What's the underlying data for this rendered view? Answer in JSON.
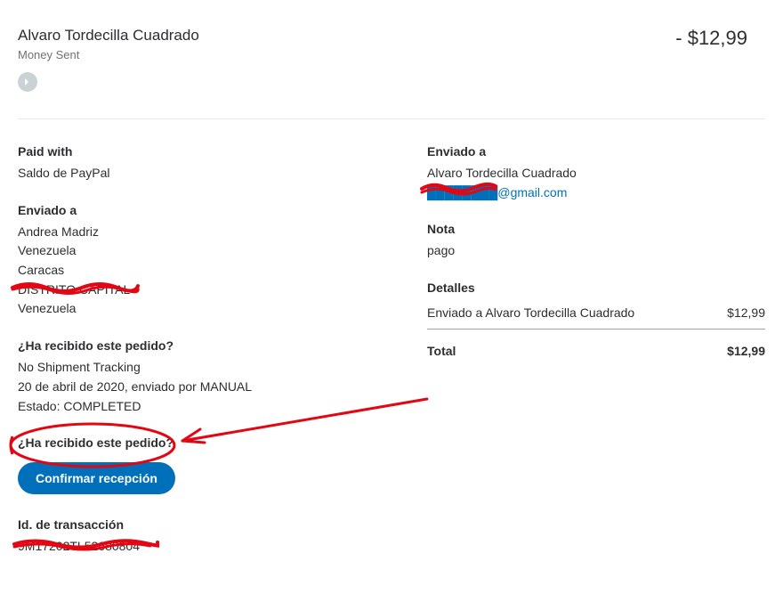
{
  "header": {
    "name": "Alvaro Tordecilla Cuadrado",
    "status": "Money Sent",
    "amount": "- $12,99"
  },
  "left": {
    "paid_with_title": "Paid with",
    "paid_with_value": "Saldo de PayPal",
    "shipped_to_title": "Enviado a",
    "ship_name": "Andrea Madriz",
    "ship_country1": "Venezuela",
    "ship_city": "Caracas",
    "ship_district": "DISTRITO CAPITAL",
    "ship_country2": "Venezuela",
    "received_q1": "¿Ha recibido este pedido?",
    "no_tracking": "No Shipment Tracking",
    "ship_date": "20 de abril de 2020, enviado por MANUAL",
    "state": "Estado: COMPLETED",
    "received_q2": "¿Ha recibido este pedido?",
    "confirm_btn": "Confirmar recepción",
    "txn_title": "Id. de transacción",
    "txn_value": "9M17202TL52680804"
  },
  "right": {
    "sent_to_title": "Enviado a",
    "sent_to_name": "Alvaro Tordecilla Cuadrado",
    "email_redacted": "████████",
    "email_visible": "@gmail.com",
    "note_title": "Nota",
    "note_value": "pago",
    "details_title": "Detalles",
    "details_text": "Enviado a Alvaro Tordecilla Cuadrado",
    "details_amount": "$12,99",
    "total_label": "Total",
    "total_amount": "$12,99"
  }
}
